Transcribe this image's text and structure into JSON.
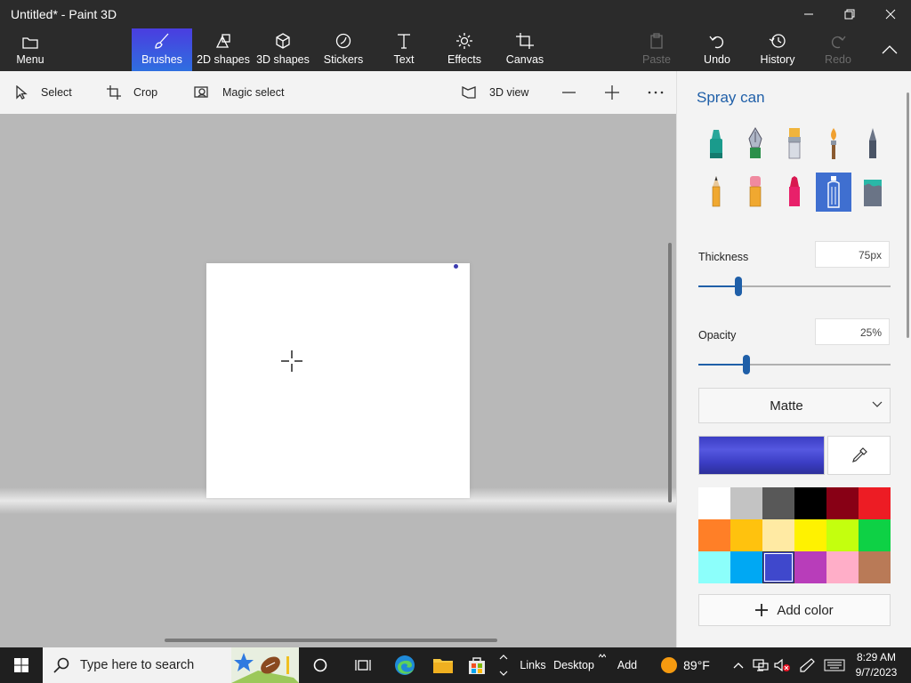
{
  "window": {
    "title": "Untitled* - Paint 3D"
  },
  "ribbon": {
    "menu": "Menu",
    "brushes": "Brushes",
    "shapes2d": "2D shapes",
    "shapes3d": "3D shapes",
    "stickers": "Stickers",
    "text": "Text",
    "effects": "Effects",
    "canvas": "Canvas",
    "paste": "Paste",
    "undo": "Undo",
    "history": "History",
    "redo": "Redo"
  },
  "toolbar": {
    "select": "Select",
    "crop": "Crop",
    "magic_select": "Magic select",
    "view3d": "3D view"
  },
  "panel": {
    "title": "Spray can",
    "brushes": [
      "marker",
      "calligraphy-pen",
      "oil-brush",
      "watercolor",
      "pixel-pen",
      "pencil",
      "eraser",
      "crayon",
      "spray-can",
      "fill"
    ],
    "selected_brush": "spray-can",
    "thickness_label": "Thickness",
    "thickness_value": "75px",
    "thickness_fraction": 0.21,
    "opacity_label": "Opacity",
    "opacity_value": "25%",
    "opacity_fraction": 0.25,
    "finish": "Matte",
    "current_color": "#3b3dc4",
    "palette": [
      "#ffffff",
      "#c3c3c3",
      "#585858",
      "#000000",
      "#880015",
      "#ed1c24",
      "#ff7f27",
      "#ffc20e",
      "#ffeaa3",
      "#fff200",
      "#c4ff0e",
      "#0ed145",
      "#8cfffb",
      "#00a8f3",
      "#3f48cc",
      "#b83dba",
      "#ffaec8",
      "#b97a57"
    ],
    "selected_swatch": 14,
    "add_color": "Add color"
  },
  "taskbar": {
    "search_placeholder": "Type here to search",
    "links": "Links",
    "desktop": "Desktop",
    "add": "Add",
    "weather": "89°F",
    "time": "8:29 AM",
    "date": "9/7/2023"
  }
}
